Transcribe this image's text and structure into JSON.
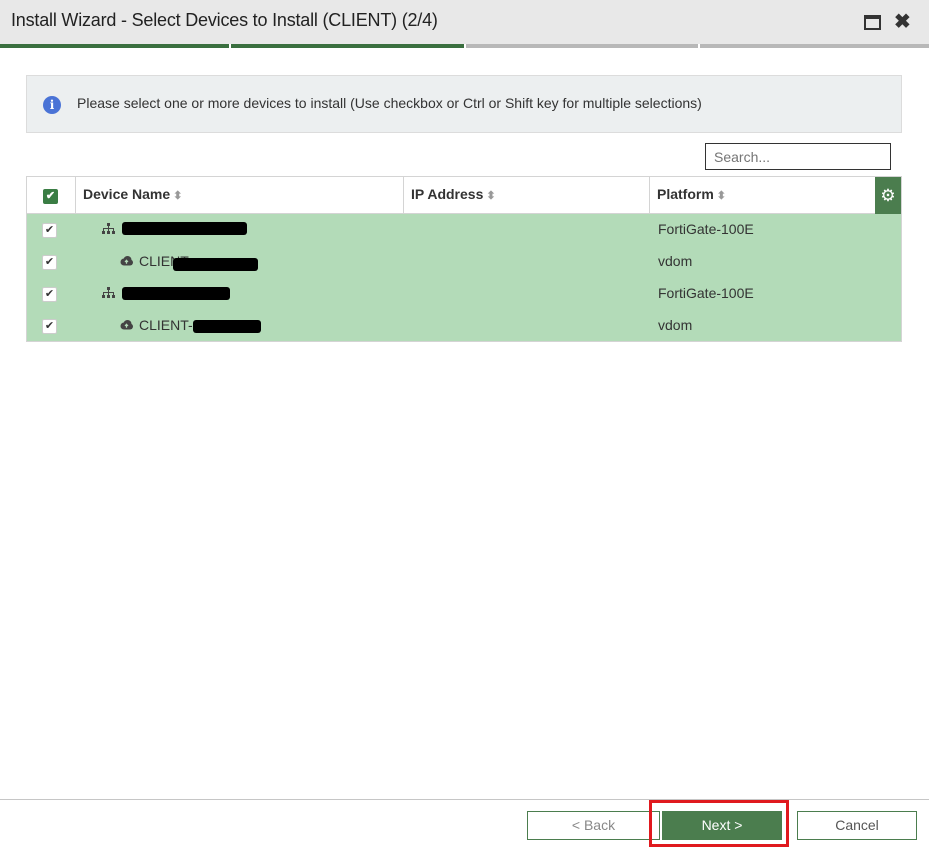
{
  "window": {
    "title": "Install Wizard - Select Devices to Install (CLIENT) (2/4)",
    "maximize_icon": "maximize-icon",
    "close_glyph": "✖"
  },
  "progress": {
    "step": 2,
    "total": 4,
    "done_color": "#3a6f3f",
    "todo_color": "#b8b8b8"
  },
  "info_banner": {
    "icon": "info-icon",
    "icon_glyph": "i",
    "text": "Please select one or more devices to install (Use checkbox or Ctrl or Shift key for multiple selections)"
  },
  "search": {
    "placeholder": "Search..."
  },
  "table": {
    "columns": [
      {
        "label": "Device Name",
        "sort": "⬍"
      },
      {
        "label": "IP Address",
        "sort": "⬍"
      },
      {
        "label": "Platform",
        "sort": "⬍"
      }
    ],
    "settings_icon": "gear-icon",
    "settings_glyph": "⚙",
    "check_glyph": "✔",
    "select_all_checked": true,
    "rows": [
      {
        "checked": true,
        "icon": "device-tree-icon",
        "name": "",
        "ip": "",
        "platform": "FortiGate-100E"
      },
      {
        "checked": true,
        "icon": "cloud-icon",
        "name": "CLIENT-",
        "ip": "",
        "platform": "vdom"
      },
      {
        "checked": true,
        "icon": "device-tree-icon",
        "name": "",
        "ip": "",
        "platform": "FortiGate-100E"
      },
      {
        "checked": true,
        "icon": "cloud-icon",
        "name": "CLIENT-",
        "ip": "",
        "platform": "vdom"
      }
    ],
    "row_highlight_color": "#b3dbb8"
  },
  "footer": {
    "back_label": "< Back",
    "next_label": "Next >",
    "cancel_label": "Cancel",
    "highlight_color": "#e0191e"
  }
}
